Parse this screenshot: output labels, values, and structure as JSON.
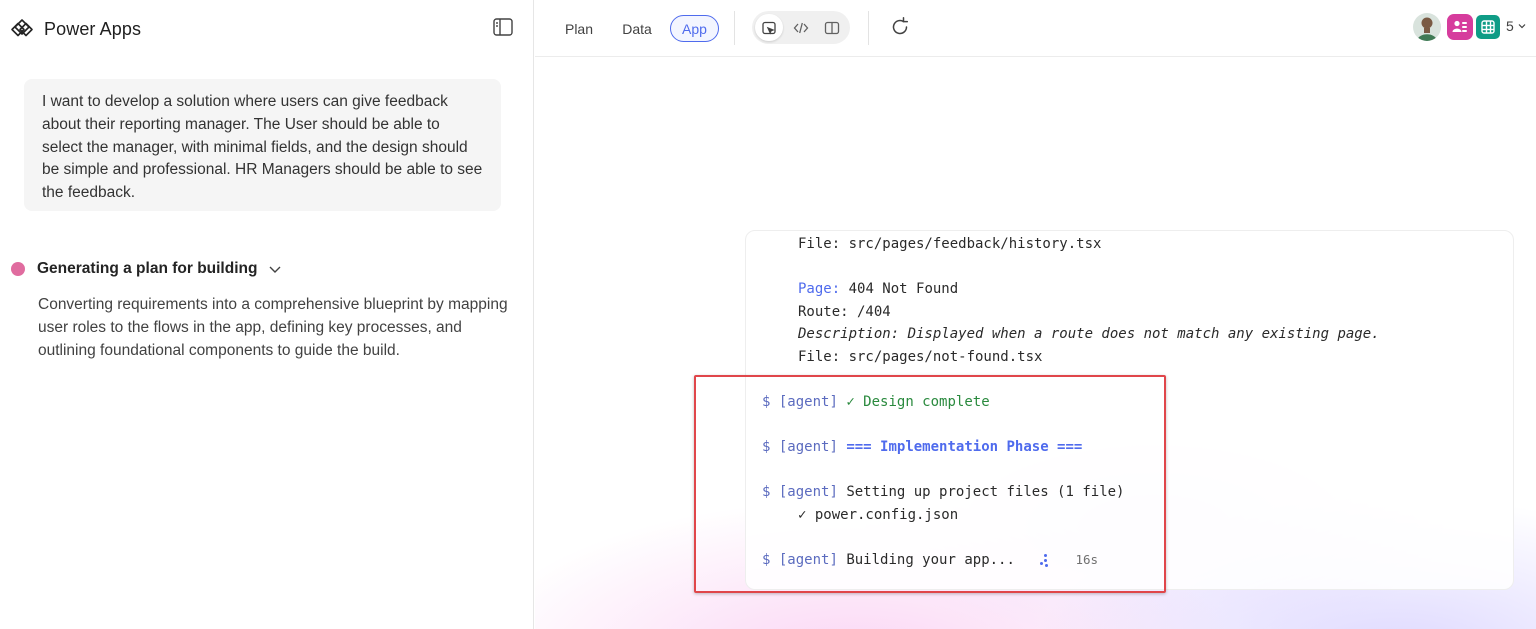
{
  "app": {
    "title": "Power Apps"
  },
  "sidebar": {
    "prompt_text": "I want to develop a solution where users can give feedback about their reporting manager. The User should be able to select the manager, with minimal fields, and the design should be simple and professional. HR Managers should be able to see the feedback.",
    "status": {
      "label": "Generating a plan for building",
      "description": "Converting requirements into a comprehensive blueprint by mapping user roles to the flows in the app, defining key processes, and outlining foundational components to guide the build.",
      "dot_color": "#e06c9f"
    }
  },
  "toolbar": {
    "tabs": [
      {
        "label": "Plan"
      },
      {
        "label": "Data"
      },
      {
        "label": "App",
        "selected": true
      }
    ],
    "view_icons": [
      "preview-icon",
      "code-icon",
      "split-view-icon"
    ],
    "refresh_icon": "refresh-icon",
    "collaborator_count": "5",
    "accent_color": "#4f6bed"
  },
  "log": {
    "history_file": "File: src/pages/feedback/history.tsx",
    "page_key": "Page:",
    "page_value": " 404 Not Found",
    "route": "Route: /404",
    "description": "Description: Displayed when a route does not match any existing page.",
    "file": "File: src/pages/not-found.tsx",
    "prompt_symbol": "$",
    "agent_tag": "[agent]",
    "design_complete": "✓ Design complete",
    "phase": "=== Implementation Phase ===",
    "setup": "Setting up project files (1 file)",
    "config_file": "✓ power.config.json",
    "building": "Building your app...",
    "elapsed": "16s"
  }
}
